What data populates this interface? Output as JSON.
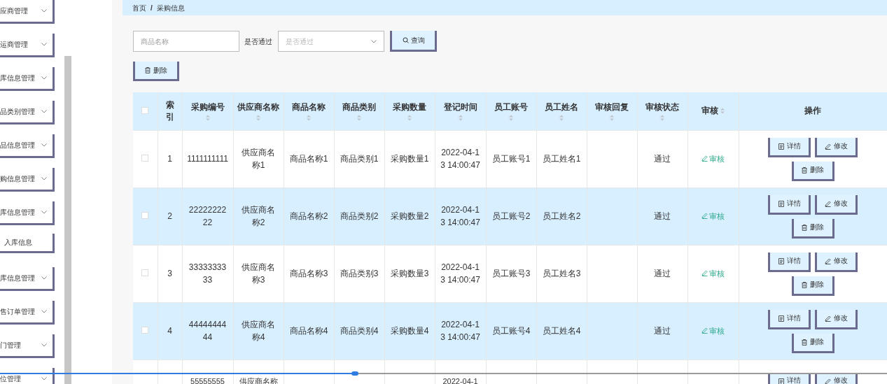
{
  "sidebar": {
    "items": [
      {
        "label": "应商管理",
        "kind": "group"
      },
      {
        "label": "运商管理",
        "kind": "group"
      },
      {
        "label": "库信息管理",
        "kind": "group"
      },
      {
        "label": "品类别管理",
        "kind": "group"
      },
      {
        "label": "品信息管理",
        "kind": "group"
      },
      {
        "label": "购信息管理",
        "kind": "group"
      },
      {
        "label": "库信息管理",
        "kind": "group"
      },
      {
        "label": "入库信息",
        "kind": "link"
      },
      {
        "label": "库信息管理",
        "kind": "group"
      },
      {
        "label": "售订单管理",
        "kind": "group"
      },
      {
        "label": "门管理",
        "kind": "group"
      },
      {
        "label": "位管理",
        "kind": "group"
      }
    ]
  },
  "breadcrumb": [
    "首页",
    "/",
    "采购信息"
  ],
  "search": {
    "name_field": {
      "placeholder": "商品名称"
    },
    "pass_label": "是否通过",
    "pass_select": {
      "placeholder": "是否通过"
    },
    "query_button": "查询"
  },
  "delete_button": "删除",
  "table": {
    "header_checkbox": {
      "checked": false
    },
    "columns": [
      {
        "label": "索引",
        "sortable": false,
        "kind": "text"
      },
      {
        "label": "采购编号",
        "sortable": true,
        "kind": "text"
      },
      {
        "label": "供应商名称",
        "sortable": true,
        "kind": "text"
      },
      {
        "label": "商品名称",
        "sortable": true,
        "kind": "text"
      },
      {
        "label": "商品类别",
        "sortable": true,
        "kind": "text"
      },
      {
        "label": "采购数量",
        "sortable": true,
        "kind": "text"
      },
      {
        "label": "登记时间",
        "sortable": true,
        "kind": "text"
      },
      {
        "label": "员工账号",
        "sortable": true,
        "kind": "text"
      },
      {
        "label": "员工姓名",
        "sortable": true,
        "kind": "text"
      },
      {
        "label": "审核回复",
        "sortable": true,
        "kind": "text"
      },
      {
        "label": "审核状态",
        "sortable": true,
        "kind": "text"
      },
      {
        "label": "审核",
        "sortable": true,
        "kind": "link"
      },
      {
        "label": "操作",
        "sortable": false,
        "kind": "actions"
      }
    ],
    "rows": [
      {
        "checked": false,
        "cells": [
          "1",
          "1111111111",
          "供应商名称1",
          "商品名称1",
          "商品类别1",
          "采购数量1",
          "2022-04-13 14:00:47",
          "员工账号1",
          "员工姓名1",
          null,
          "通过",
          "审核",
          [
            {
              "kind": "detail",
              "label": "详情"
            },
            {
              "kind": "edit",
              "label": "修改"
            },
            {
              "kind": "delete",
              "label": "删除"
            }
          ]
        ]
      },
      {
        "checked": false,
        "cells": [
          "2",
          "2222222222",
          "供应商名称2",
          "商品名称2",
          "商品类别2",
          "采购数量2",
          "2022-04-13 14:00:47",
          "员工账号2",
          "员工姓名2",
          null,
          "通过",
          "审核",
          [
            {
              "kind": "detail",
              "label": "详情"
            },
            {
              "kind": "edit",
              "label": "修改"
            },
            {
              "kind": "delete",
              "label": "删除"
            }
          ]
        ]
      },
      {
        "checked": false,
        "cells": [
          "3",
          "3333333333",
          "供应商名称3",
          "商品名称3",
          "商品类别3",
          "采购数量3",
          "2022-04-13 14:00:47",
          "员工账号3",
          "员工姓名3",
          null,
          "通过",
          "审核",
          [
            {
              "kind": "detail",
              "label": "详情"
            },
            {
              "kind": "edit",
              "label": "修改"
            },
            {
              "kind": "delete",
              "label": "删除"
            }
          ]
        ]
      },
      {
        "checked": false,
        "cells": [
          "4",
          "4444444444",
          "供应商名称4",
          "商品名称4",
          "商品类别4",
          "采购数量4",
          "2022-04-13 14:00:47",
          "员工账号4",
          "员工姓名4",
          null,
          "通过",
          "审核",
          [
            {
              "kind": "detail",
              "label": "详情"
            },
            {
              "kind": "edit",
              "label": "修改"
            },
            {
              "kind": "delete",
              "label": "删除"
            }
          ]
        ]
      },
      {
        "cells": [
          null,
          "55555555",
          "供应商名称",
          null,
          null,
          null,
          "2022-04-1",
          null,
          null,
          null,
          null,
          null,
          [
            {
              "kind": "detail",
              "label": "详情"
            },
            {
              "kind": "edit",
              "label": "修改"
            }
          ]
        ]
      }
    ]
  },
  "seek_bar": {
    "level": 0.4
  }
}
